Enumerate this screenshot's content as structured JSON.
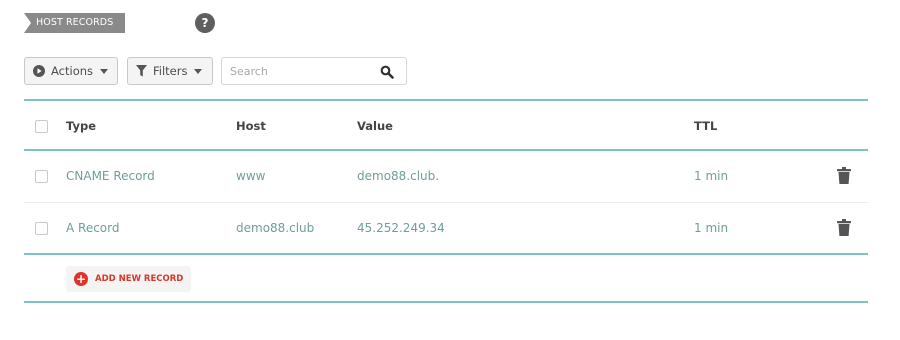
{
  "section": {
    "title": "HOST RECORDS",
    "help_symbol": "?"
  },
  "toolbar": {
    "actions_label": "Actions",
    "filters_label": "Filters",
    "search_placeholder": "Search"
  },
  "table": {
    "columns": {
      "type": "Type",
      "host": "Host",
      "value": "Value",
      "ttl": "TTL"
    },
    "rows": [
      {
        "type": "CNAME Record",
        "host": "www",
        "value": "demo88.club.",
        "ttl": "1 min"
      },
      {
        "type": "A Record",
        "host": "demo88.club",
        "value": "45.252.249.34",
        "ttl": "1 min"
      }
    ]
  },
  "add_record": {
    "label": "ADD NEW RECORD"
  },
  "colors": {
    "accent_rule": "#7ec2bf",
    "data_text": "#6f9d9a",
    "add_red": "#e0332a"
  },
  "icons": [
    "play-circle-icon",
    "filter-icon",
    "search-icon",
    "trash-icon",
    "plus-circle-icon",
    "help-icon"
  ]
}
